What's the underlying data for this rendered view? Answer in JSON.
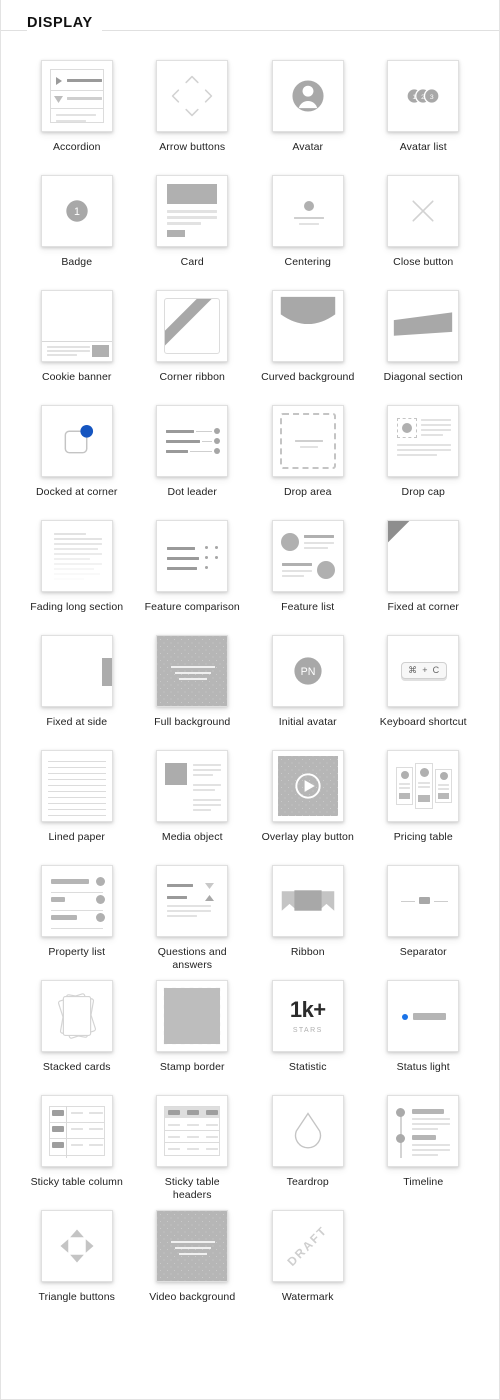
{
  "section": {
    "title": "DISPLAY"
  },
  "items": [
    {
      "label": "Accordion",
      "icon": "accordion-icon"
    },
    {
      "label": "Arrow buttons",
      "icon": "arrow-buttons-icon"
    },
    {
      "label": "Avatar",
      "icon": "avatar-icon"
    },
    {
      "label": "Avatar list",
      "icon": "avatar-list-icon",
      "badges": [
        "1",
        "2",
        "3"
      ]
    },
    {
      "label": "Badge",
      "icon": "badge-icon",
      "value": "1"
    },
    {
      "label": "Card",
      "icon": "card-icon"
    },
    {
      "label": "Centering",
      "icon": "centering-icon"
    },
    {
      "label": "Close button",
      "icon": "close-button-icon"
    },
    {
      "label": "Cookie banner",
      "icon": "cookie-banner-icon"
    },
    {
      "label": "Corner ribbon",
      "icon": "corner-ribbon-icon"
    },
    {
      "label": "Curved background",
      "icon": "curved-background-icon"
    },
    {
      "label": "Diagonal section",
      "icon": "diagonal-section-icon"
    },
    {
      "label": "Docked at corner",
      "icon": "docked-at-corner-icon",
      "accent": "#1555c0"
    },
    {
      "label": "Dot leader",
      "icon": "dot-leader-icon"
    },
    {
      "label": "Drop area",
      "icon": "drop-area-icon"
    },
    {
      "label": "Drop cap",
      "icon": "drop-cap-icon"
    },
    {
      "label": "Fading long section",
      "icon": "fading-long-section-icon"
    },
    {
      "label": "Feature comparison",
      "icon": "feature-comparison-icon"
    },
    {
      "label": "Feature list",
      "icon": "feature-list-icon"
    },
    {
      "label": "Fixed at corner",
      "icon": "fixed-at-corner-icon"
    },
    {
      "label": "Fixed at side",
      "icon": "fixed-at-side-icon"
    },
    {
      "label": "Full background",
      "icon": "full-background-icon"
    },
    {
      "label": "Initial avatar",
      "icon": "initial-avatar-icon",
      "value": "PN"
    },
    {
      "label": "Keyboard shortcut",
      "icon": "keyboard-shortcut-icon",
      "value": "⌘ + C"
    },
    {
      "label": "Lined paper",
      "icon": "lined-paper-icon"
    },
    {
      "label": "Media object",
      "icon": "media-object-icon"
    },
    {
      "label": "Overlay play button",
      "icon": "overlay-play-button-icon"
    },
    {
      "label": "Pricing table",
      "icon": "pricing-table-icon"
    },
    {
      "label": "Property list",
      "icon": "property-list-icon"
    },
    {
      "label": "Questions and answers",
      "icon": "questions-and-answers-icon"
    },
    {
      "label": "Ribbon",
      "icon": "ribbon-icon"
    },
    {
      "label": "Separator",
      "icon": "separator-icon"
    },
    {
      "label": "Stacked cards",
      "icon": "stacked-cards-icon"
    },
    {
      "label": "Stamp border",
      "icon": "stamp-border-icon"
    },
    {
      "label": "Statistic",
      "icon": "statistic-icon",
      "value": "1k+",
      "caption": "STARS"
    },
    {
      "label": "Status light",
      "icon": "status-light-icon",
      "accent": "#1a73e8"
    },
    {
      "label": "Sticky table column",
      "icon": "sticky-table-column-icon"
    },
    {
      "label": "Sticky table headers",
      "icon": "sticky-table-headers-icon"
    },
    {
      "label": "Teardrop",
      "icon": "teardrop-icon"
    },
    {
      "label": "Timeline",
      "icon": "timeline-icon"
    },
    {
      "label": "Triangle buttons",
      "icon": "triangle-buttons-icon"
    },
    {
      "label": "Video background",
      "icon": "video-background-icon"
    },
    {
      "label": "Watermark",
      "icon": "watermark-icon",
      "value": "DRAFT"
    }
  ]
}
